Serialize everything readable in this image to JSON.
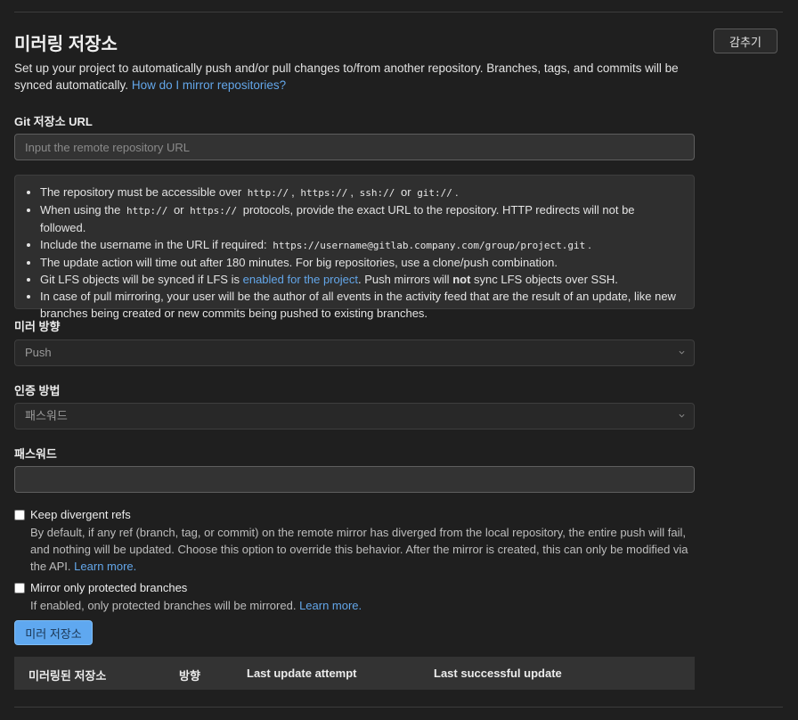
{
  "section": {
    "title": "미러링 저장소",
    "collapse_label": "감추기",
    "description_text": "Set up your project to automatically push and/or pull changes to/from another repository. Branches, tags, and commits will be synced automatically.",
    "help_link": "How do I mirror repositories?"
  },
  "git_url": {
    "label": "Git 저장소 URL",
    "value": "",
    "placeholder": "Input the remote repository URL"
  },
  "help": {
    "item1_text": "The repository must be accessible over",
    "proto_http": "http://",
    "proto_https": "https://",
    "proto_ssh": "ssh://",
    "proto_git": "git://",
    "sep_comma": ",",
    "sep_or": "or",
    "end_period": ".",
    "item2_a": "When using the",
    "item2_b": "protocols, provide the exact URL to the repository. HTTP redirects will not be followed.",
    "item3_a": "Include the username in the URL if required:",
    "item3_url": "https://username@gitlab.company.com/group/project.git",
    "item4": "The update action will time out after 180 minutes. For big repositories, use a clone/push combination.",
    "item5_a": "Git LFS objects will be synced if LFS is",
    "item5_link": "enabled for the project",
    "item5_b": ". Push mirrors will",
    "item5_not": "not",
    "item5_c": "sync LFS objects over SSH.",
    "item6": "In case of pull mirroring, your user will be the author of all events in the activity feed that are the result of an update, like new branches being created or new commits being pushed to existing branches."
  },
  "mirror_direction": {
    "label": "미러 방향",
    "selected": "Push"
  },
  "auth_method": {
    "label": "인증 방법",
    "selected": "패스워드"
  },
  "password": {
    "label": "패스워드",
    "value": ""
  },
  "keep_divergent": {
    "label": "Keep divergent refs",
    "help": "By default, if any ref (branch, tag, or commit) on the remote mirror has diverged from the local repository, the entire push will fail, and nothing will be updated. Choose this option to override this behavior. After the mirror is created, this can only be modified via the API.",
    "learn_more": "Learn more."
  },
  "protected_only": {
    "label": "Mirror only protected branches",
    "help": "If enabled, only protected branches will be mirrored.",
    "learn_more": "Learn more."
  },
  "submit_label": "미러 저장소",
  "table": {
    "columns": [
      "미러링된 저장소",
      "방향",
      "Last update attempt",
      "Last successful update"
    ]
  },
  "colors": {
    "background": "#1f1f1f",
    "link": "#63a6e9",
    "primary_button": "#5fa8f0"
  }
}
